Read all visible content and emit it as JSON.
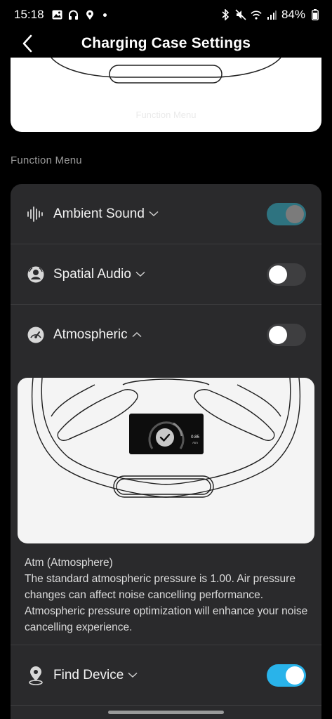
{
  "status_bar": {
    "time": "15:18",
    "battery": "84%",
    "icons_left": [
      "gallery-icon",
      "headphones-icon",
      "location-icon",
      "dot"
    ],
    "icons_right": [
      "bluetooth-icon",
      "mute-icon",
      "wifi-icon",
      "signal-icon",
      "battery-icon"
    ]
  },
  "header": {
    "title": "Charging Case Settings",
    "back_icon": "chevron-left-icon"
  },
  "preview": {
    "label": "Function Menu"
  },
  "section": {
    "label": "Function Menu"
  },
  "functions": [
    {
      "label": "Ambient Sound",
      "icon": "sound-wave-icon",
      "expanded": false,
      "enabled": true,
      "toggle_style": "dimmed"
    },
    {
      "label": "Spatial Audio",
      "icon": "spatial-audio-icon",
      "expanded": false,
      "enabled": false
    },
    {
      "label": "Atmospheric",
      "icon": "gauge-icon",
      "expanded": true,
      "enabled": false
    },
    {
      "label": "Find Device",
      "icon": "location-pin-icon",
      "expanded": false,
      "enabled": true
    }
  ],
  "atmospheric_detail": {
    "screen_value": "0.85",
    "screen_unit": "Atm",
    "description": "Atm (Atmosphere)\nThe standard atmospheric pressure is 1.00. Air pressure changes can affect noise cancelling performance. Atmospheric pressure optimization will enhance your noise cancelling experience."
  },
  "colors": {
    "background": "#000000",
    "card": "#2a2a2c",
    "toggle_on": "#29b3ea",
    "toggle_on_dimmed": "#2e7380",
    "toggle_off": "#3e3e40"
  }
}
